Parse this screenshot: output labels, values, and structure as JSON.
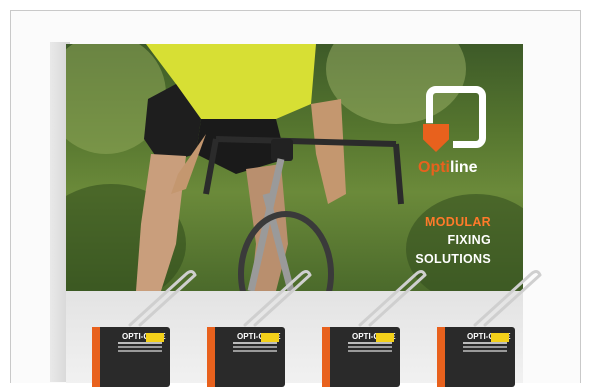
{
  "display": {
    "brand_prefix": "Opti",
    "brand_suffix": "line",
    "tagline": [
      "MODULAR",
      "FIXING",
      "SOLUTIONS"
    ]
  },
  "products": [
    {
      "label": "OPTI-CASE"
    },
    {
      "label": "OPTI-CASE"
    },
    {
      "label": "OPTI-CASE"
    },
    {
      "label": "OPTI-CASE"
    }
  ],
  "colors": {
    "brand_orange": "#e8611d",
    "foliage": "#56762f",
    "shelf": "#e6e6e6",
    "jersey": "#d9e23a"
  }
}
